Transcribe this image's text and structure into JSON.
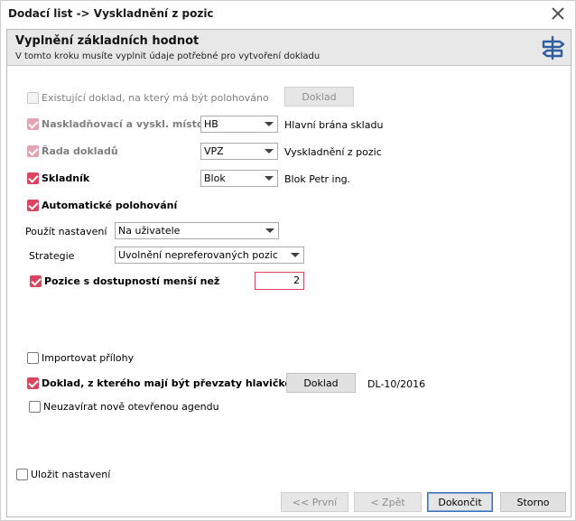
{
  "window": {
    "title": "Dodací list -> Vyskladnění z pozic"
  },
  "header": {
    "title": "Vyplnění základních hodnot",
    "subtitle": "V tomto kroku musíte vyplnit údaje potřebné pro vytvoření dokladu"
  },
  "form": {
    "existing_doc": {
      "label": "Existující doklad, na který má být polohováno",
      "checked": false,
      "button": "Doklad"
    },
    "place": {
      "label": "Naskladňovací a vyskl. místo",
      "value": "HB",
      "desc": "Hlavní brána skladu"
    },
    "series": {
      "label": "Řada dokladů",
      "value": "VPZ",
      "desc": "Vyskladnění z pozic"
    },
    "storekeeper": {
      "label": "Skladník",
      "value": "Blok",
      "desc": "Blok Petr ing."
    },
    "auto_positioning": {
      "label": "Automatické polohování"
    },
    "use_settings": {
      "label": "Použít nastavení",
      "value": "Na uživatele"
    },
    "strategy": {
      "label": "Strategie",
      "value": "Uvolnění nepreferovaných pozic"
    },
    "positions_less": {
      "label": "Pozice s dostupností menší než",
      "value": "2"
    },
    "import_attachments": {
      "label": "Importovat přílohy"
    },
    "header_doc": {
      "label": "Doklad, z kterého mají být převzaty hlavičkové údaje",
      "button": "Doklad",
      "value": "DL-10/2016"
    },
    "keep_open": {
      "label": "Neuzavírat nově otevřenou agendu"
    }
  },
  "footer": {
    "save_settings": "Uložit nastavení",
    "first": "<< První",
    "back": "< Zpět",
    "finish": "Dokončit",
    "cancel": "Storno"
  },
  "colors": {
    "accent": "#d9455f",
    "header_bg": "#e8e8e8",
    "icon": "#2f5f9e"
  },
  "icons": {
    "close": "close-icon",
    "header": "signpost-icon"
  }
}
